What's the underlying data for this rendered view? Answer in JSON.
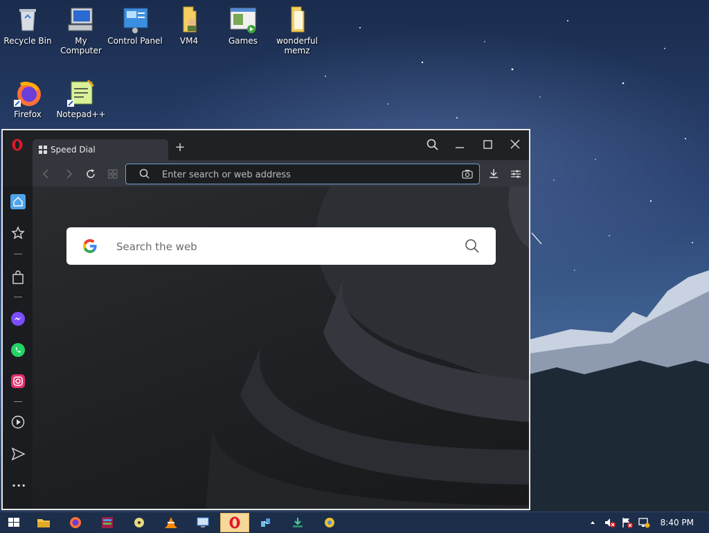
{
  "desktop": {
    "icons": [
      {
        "label": "Recycle Bin"
      },
      {
        "label": "My Computer"
      },
      {
        "label": "Control Panel"
      },
      {
        "label": "VM4"
      },
      {
        "label": "Games"
      },
      {
        "label": "wonderful memz"
      },
      {
        "label": "Firefox"
      },
      {
        "label": "Notepad++"
      }
    ]
  },
  "browser": {
    "tab_label": "Speed Dial",
    "new_tab": "+",
    "address_placeholder": "Enter search or web address",
    "search_placeholder": "Search the web",
    "sidebar_more": "..."
  },
  "taskbar": {
    "clock": "8:40 PM"
  },
  "colors": {
    "accent": "#6e9ed6",
    "opera_red": "#e0182c",
    "messenger": "#7b4dff",
    "whatsapp": "#25d366",
    "instagram": "#e1306c"
  }
}
